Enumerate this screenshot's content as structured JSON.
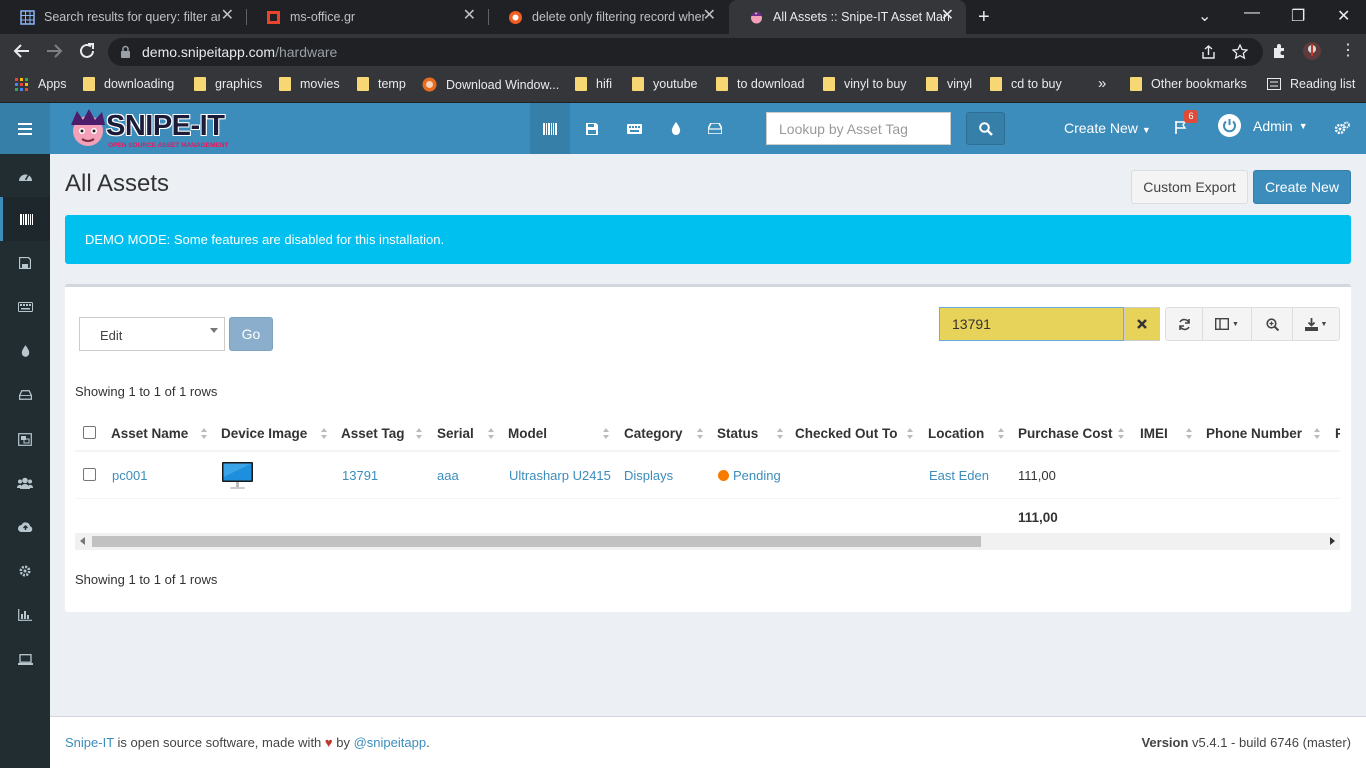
{
  "browser": {
    "tabs": [
      {
        "title": "Search results for query: filter and"
      },
      {
        "title": "ms-office.gr"
      },
      {
        "title": "delete only filtering record when"
      },
      {
        "title": "All Assets :: Snipe-IT Asset Manag"
      }
    ],
    "url_host": "demo.snipeitapp.com",
    "url_path": "/hardware",
    "bookmarks": [
      {
        "label": "Apps"
      },
      {
        "label": "downloading"
      },
      {
        "label": "graphics"
      },
      {
        "label": "movies"
      },
      {
        "label": "temp"
      },
      {
        "label": "Download Window..."
      },
      {
        "label": "hifi"
      },
      {
        "label": "youtube"
      },
      {
        "label": "to download"
      },
      {
        "label": "vinyl to buy"
      },
      {
        "label": "vinyl"
      },
      {
        "label": "cd to buy"
      },
      {
        "label": "Other bookmarks"
      },
      {
        "label": "Reading list"
      }
    ],
    "bookmarks_overflow": "»"
  },
  "header": {
    "logo_text": "SNIPE-IT",
    "logo_tagline": "OPEN SOURCE ASSET MANAGEMENT",
    "lookup_placeholder": "Lookup by Asset Tag",
    "create_new": "Create New",
    "notifications_count": "6",
    "user": "Admin"
  },
  "page": {
    "title": "All Assets",
    "custom_export": "Custom Export",
    "create_new": "Create New",
    "demo_alert": "DEMO MODE: Some features are disabled for this installation."
  },
  "table": {
    "bulk_action": "Edit",
    "go": "Go",
    "search_value": "13791",
    "showing_top": "Showing 1 to 1 of 1 rows",
    "showing_bottom": "Showing 1 to 1 of 1 rows",
    "columns": [
      "Asset Name",
      "Device Image",
      "Asset Tag",
      "Serial",
      "Model",
      "Category",
      "Status",
      "Checked Out To",
      "Location",
      "Purchase Cost",
      "IMEI",
      "Phone Number",
      "F"
    ],
    "rows": [
      {
        "asset_name": "pc001",
        "asset_tag": "13791",
        "serial": "aaa",
        "model": "Ultrasharp U2415",
        "category": "Displays",
        "status": "Pending",
        "checked_out_to": "",
        "location": "East Eden",
        "purchase_cost": "111,00"
      }
    ],
    "total_purchase_cost": "111,00"
  },
  "footer": {
    "app_link": "Snipe-IT",
    "text": " is open source software, made with ",
    "by": " by ",
    "author_link": "@snipeitapp",
    "period": ".",
    "version_label": "Version",
    "version_value": " v5.4.1 - build 6746 (master)"
  },
  "colors": {
    "header": "#3c8dbc",
    "sidebar": "#222d32",
    "alert": "#00c0ef",
    "search_highlight": "#e8d35a",
    "status_pending": "#f39c12"
  }
}
